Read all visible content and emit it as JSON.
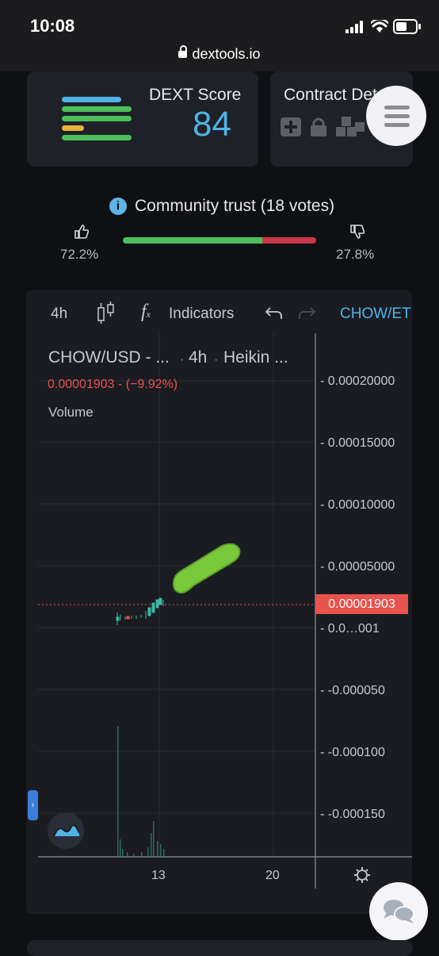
{
  "statusbar": {
    "time": "10:08",
    "url": "dextools.io"
  },
  "dext": {
    "title": "DEXT Score",
    "score": "84"
  },
  "contract": {
    "title": "Contract Details"
  },
  "community": {
    "text": "Community trust (18 votes)",
    "up_pct": "72.2%",
    "down_pct": "27.8%",
    "up_fraction": 0.722,
    "colors": {
      "up": "#4cbf5a",
      "down": "#c8374a"
    }
  },
  "toolbar": {
    "interval": "4h",
    "indicators": "Indicators",
    "pair": "CHOW/ETH"
  },
  "chart": {
    "title_pair": "CHOW/USD - ...",
    "title_interval": "4h",
    "title_type": "Heikin ...",
    "price_change": "0.00001903 - (−9.92%)",
    "volume_label": "Volume",
    "y_ticks": [
      "0.00020000",
      "0.00015000",
      "0.00010000",
      "0.00005000",
      "0.0…001",
      "-0.000050",
      "-0.000100",
      "-0.000150"
    ],
    "current_price": "0.00001903",
    "x_ticks": [
      "13",
      "20"
    ]
  }
}
